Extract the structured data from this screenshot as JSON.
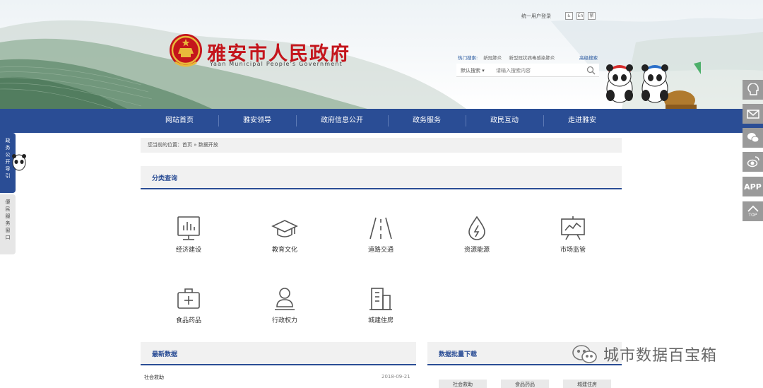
{
  "header": {
    "title": "雅安市人民政府",
    "subtitle": "Yaan Municipal People's Government",
    "top_link": "统一用户登录",
    "top_icons": [
      "♿",
      "En",
      "繁"
    ],
    "hot_search_label": "热门搜索:",
    "hot_search_items": [
      "新冠肺炎",
      "新型冠状病毒感染肺炎"
    ],
    "advanced_search": "高级搜索",
    "search_scope": "默认搜索",
    "search_placeholder": "请输入搜索内容"
  },
  "nav": {
    "items": [
      "网站首页",
      "雅安领导",
      "政府信息公开",
      "政务服务",
      "政民互动",
      "走进雅安"
    ]
  },
  "breadcrumb": "您当前的位置：首页 » 数据开放",
  "category_section": {
    "title": "分类查询",
    "items": [
      "经济建设",
      "教育文化",
      "道路交通",
      "资源能源",
      "市场监管",
      "食品药品",
      "行政权力",
      "城建住房"
    ]
  },
  "latest": {
    "title": "最新数据",
    "items": [
      {
        "name": "社会救助",
        "date": "2018-09-21"
      }
    ]
  },
  "download": {
    "title": "数据批量下载",
    "buttons": [
      "社会救助",
      "食品药品",
      "城建住房"
    ]
  },
  "left_tabs": [
    "政务公开导引",
    "便民服务窗口"
  ],
  "right_float": {
    "app_label": "APP",
    "top_label": "TOP"
  },
  "watermark": "城市数据百宝箱",
  "colors": {
    "brand_blue": "#2a4d95",
    "title_red": "#c4151c"
  }
}
